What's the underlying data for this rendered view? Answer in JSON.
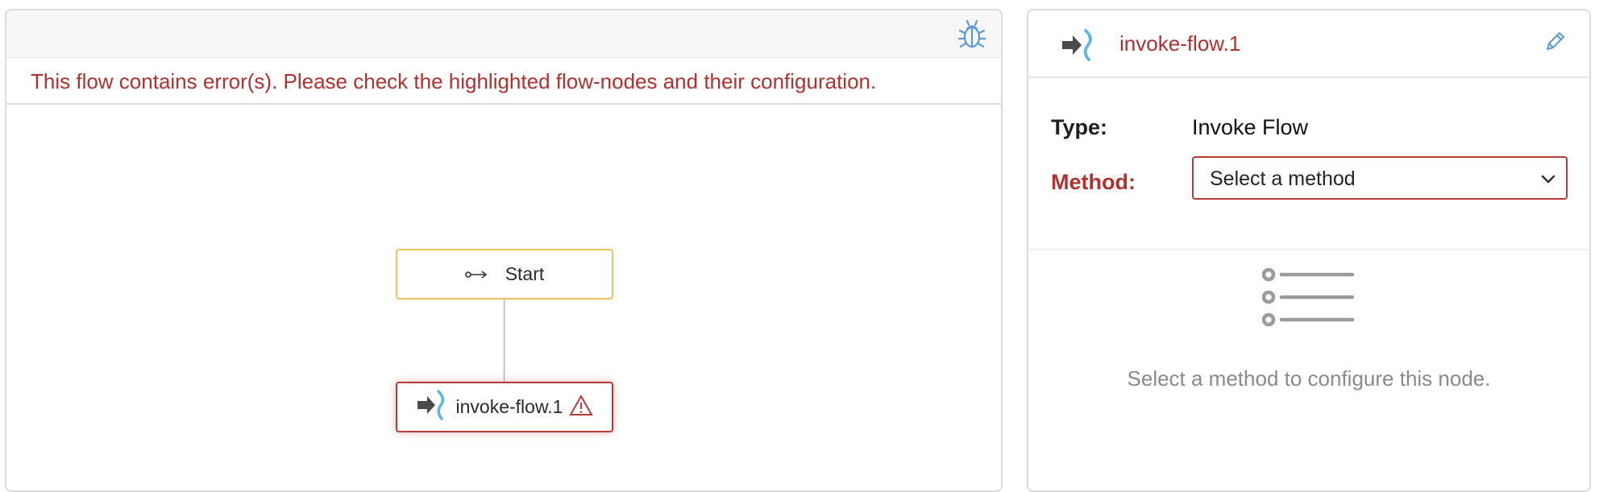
{
  "flow_editor": {
    "error_message": "This flow contains error(s). Please check the highlighted flow-nodes and their configuration.",
    "toolbar": {
      "debug_icon": "bug-icon"
    },
    "nodes": [
      {
        "id": "start",
        "label": "Start",
        "icon": "start-arrow-icon",
        "border_color": "#f2c25c"
      },
      {
        "id": "invoke-flow.1",
        "label": "invoke-flow.1",
        "icon": "invoke-flow-icon",
        "status_icon": "warning-icon",
        "border_color": "#b73b39"
      }
    ]
  },
  "node_detail": {
    "title": "invoke-flow.1",
    "edit_icon": "pencil-icon",
    "type_label": "Type:",
    "type_value": "Invoke Flow",
    "method_label": "Method:",
    "method_select": {
      "selected": "Select a method"
    },
    "empty_state": {
      "icon": "list-icon",
      "message": "Select a method to configure this node."
    }
  },
  "colors": {
    "error": "#b0312f",
    "start_border": "#f2c25c",
    "icon_blue": "#5fb6e6",
    "arrow_dark": "#4a4a4a"
  }
}
